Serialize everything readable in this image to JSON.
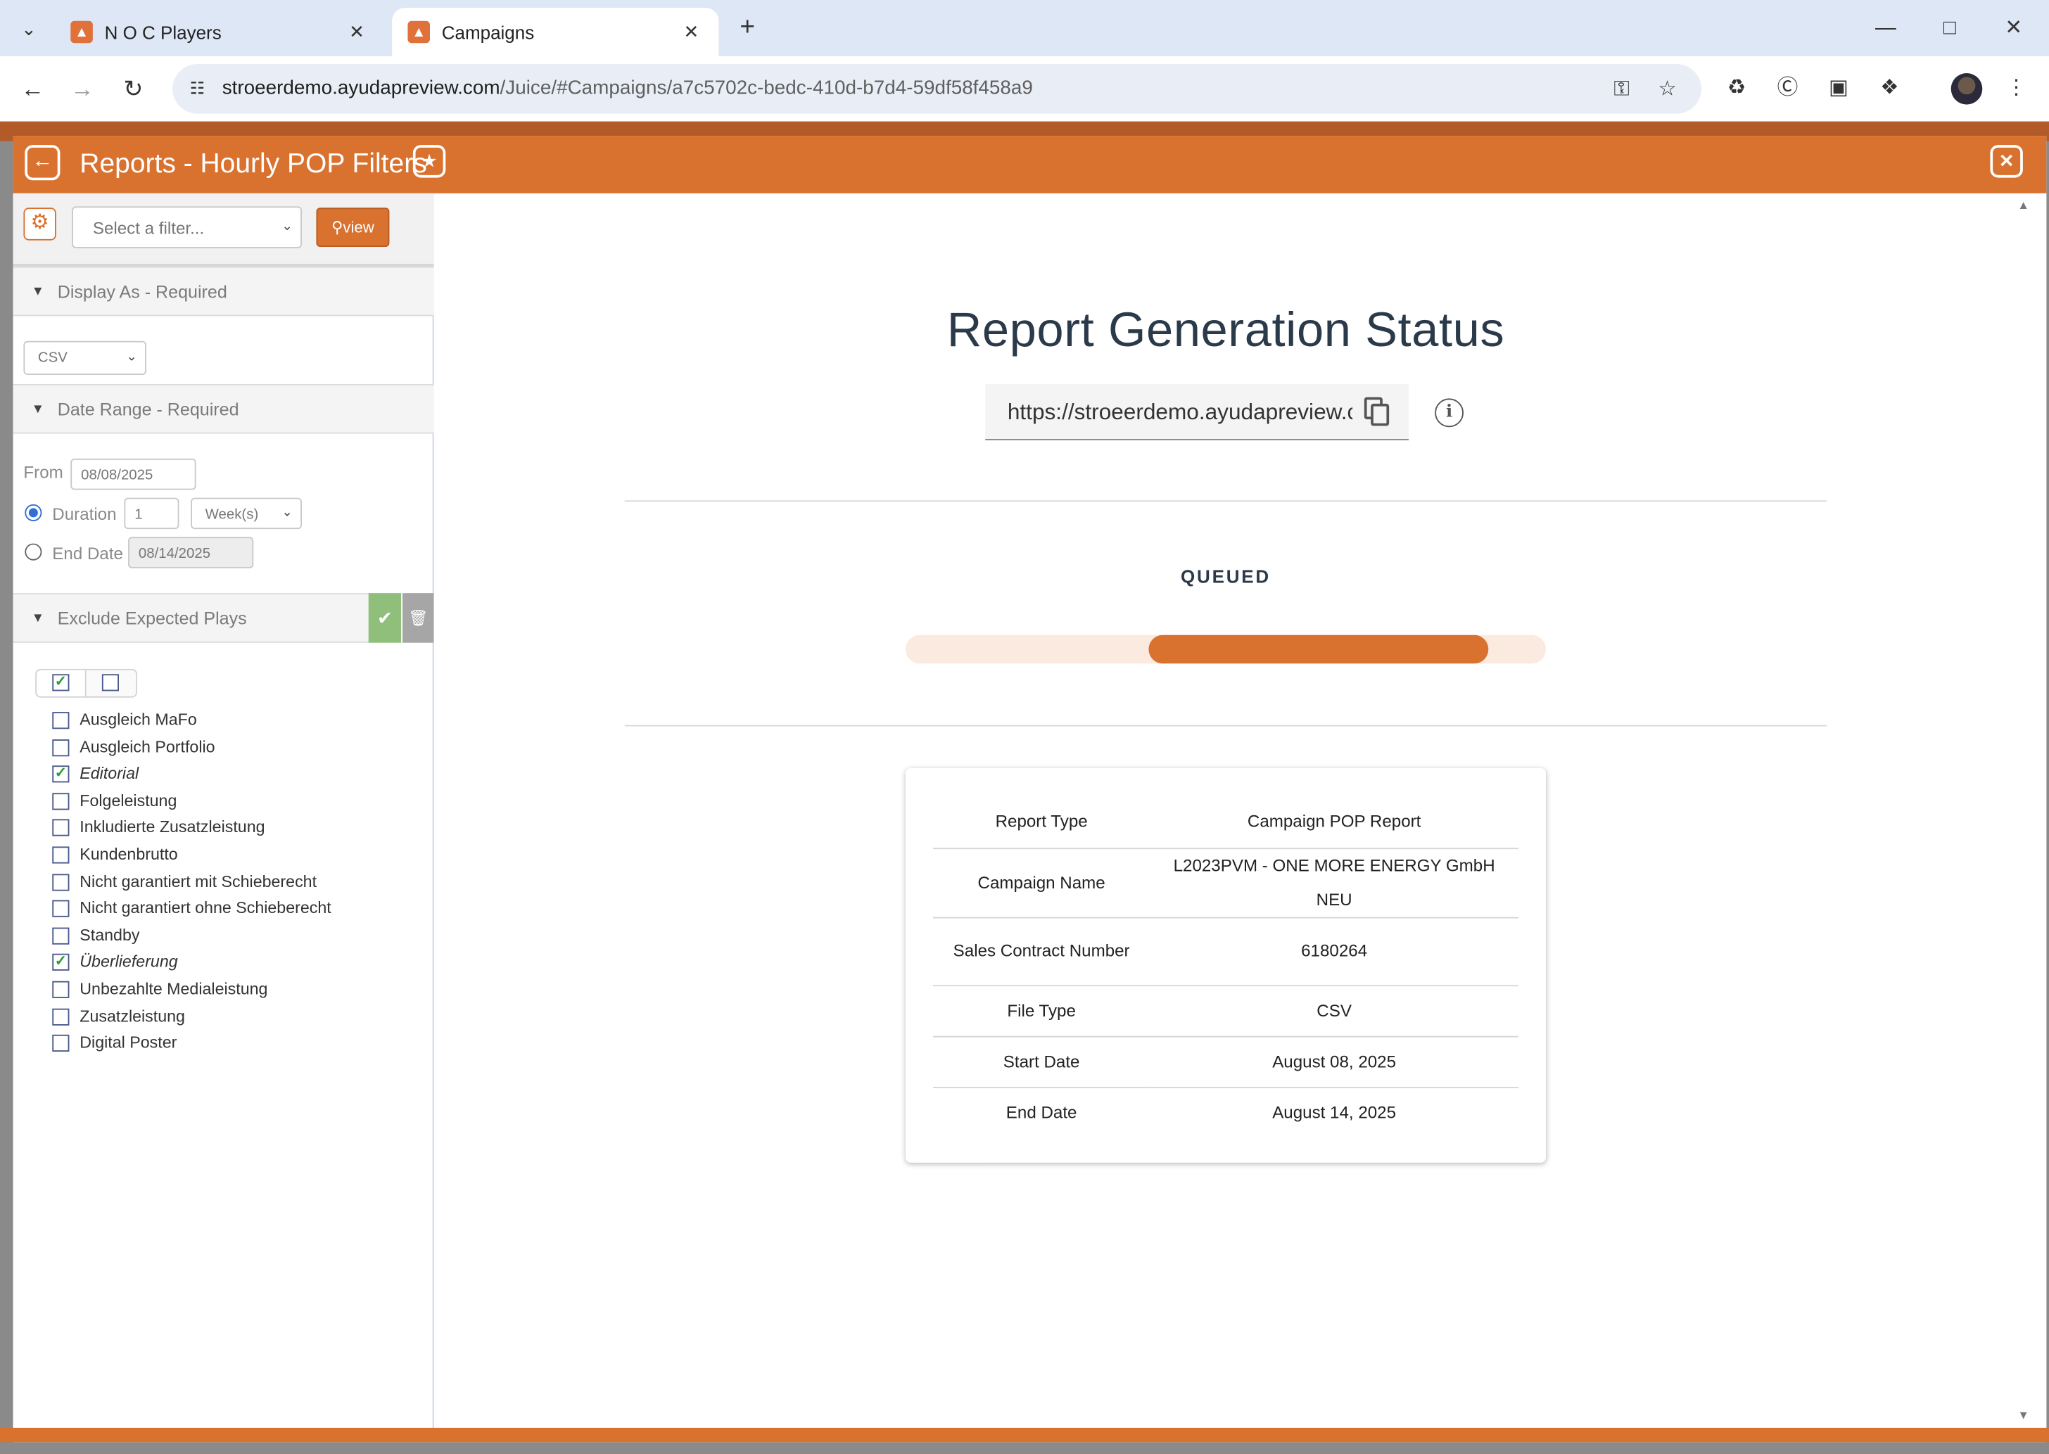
{
  "browser": {
    "tabs": [
      {
        "title": "N O C Players",
        "active": false
      },
      {
        "title": "Campaigns",
        "active": true
      }
    ],
    "url": {
      "host": "stroeerdemo.ayudapreview.com",
      "path": "/Juice/#Campaigns/a7c5702c-bedc-410d-b7d4-59df58f458a9"
    }
  },
  "modal": {
    "title": "Reports - Hourly POP Filters"
  },
  "filters": {
    "select_placeholder": "Select a filter...",
    "view_label": "view",
    "display_as": {
      "title": "Display As - Required",
      "value": "CSV"
    },
    "date_range": {
      "title": "Date Range - Required",
      "from_label": "From",
      "from_value": "08/08/2025",
      "duration_label": "Duration",
      "duration_value": "1",
      "duration_unit": "Week(s)",
      "end_date_label": "End Date",
      "end_date_value": "08/14/2025",
      "selected": "duration"
    },
    "exclude": {
      "title": "Exclude Expected Plays",
      "items": [
        {
          "label": "Ausgleich MaFo",
          "checked": false
        },
        {
          "label": "Ausgleich Portfolio",
          "checked": false
        },
        {
          "label": "Editorial",
          "checked": true
        },
        {
          "label": "Folgeleistung",
          "checked": false
        },
        {
          "label": "Inkludierte Zusatzleistung",
          "checked": false
        },
        {
          "label": "Kundenbrutto",
          "checked": false
        },
        {
          "label": "Nicht garantiert mit Schieberecht",
          "checked": false
        },
        {
          "label": "Nicht garantiert ohne Schieberecht",
          "checked": false
        },
        {
          "label": "Standby",
          "checked": false
        },
        {
          "label": "Überlieferung",
          "checked": true
        },
        {
          "label": "Unbezahlte Medialeistung",
          "checked": false
        },
        {
          "label": "Zusatzleistung",
          "checked": false
        },
        {
          "label": "Digital Poster",
          "checked": false
        }
      ]
    }
  },
  "report": {
    "heading": "Report Generation Status",
    "link": "https://stroeerdemo.ayudapreview.com/",
    "status": "QUEUED",
    "progress": {
      "start": 0.38,
      "end": 0.91
    },
    "details": [
      {
        "key": "Report Type",
        "value": "Campaign POP Report"
      },
      {
        "key": "Campaign Name",
        "value": "L2023PVM - ONE MORE ENERGY GmbH NEU"
      },
      {
        "key": "Sales Contract Number",
        "value": "6180264"
      },
      {
        "key": "File Type",
        "value": "CSV"
      },
      {
        "key": "Start Date",
        "value": "August 08, 2025"
      },
      {
        "key": "End Date",
        "value": "August 14, 2025"
      }
    ]
  },
  "colors": {
    "accent": "#d9712f",
    "progress_track": "#fbeae0",
    "confirm": "#8fbf7a",
    "checkbox_check": "#2e9a3a"
  }
}
